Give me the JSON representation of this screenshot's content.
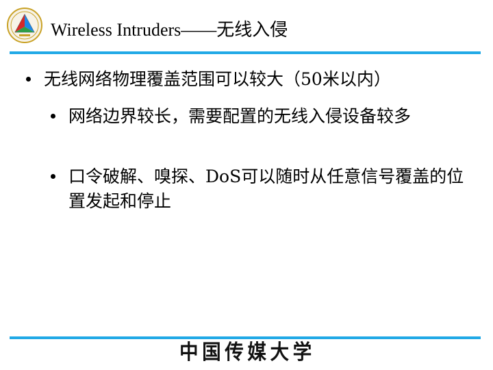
{
  "title": "Wireless Intruders——无线入侵",
  "bullets": {
    "main": "无线网络物理覆盖范围可以较大（50米以内）",
    "sub": [
      "网络边界较长，需要配置的无线入侵设备较多",
      "口令破解、嗅探、DoS可以随时从任意信号覆盖的位置发起和停止"
    ]
  },
  "footer": {
    "logo_text": "中国传媒大学"
  },
  "colors": {
    "rule": "#21a9e6",
    "text": "#000000"
  },
  "icons": {
    "logo": "university-emblem-icon"
  }
}
